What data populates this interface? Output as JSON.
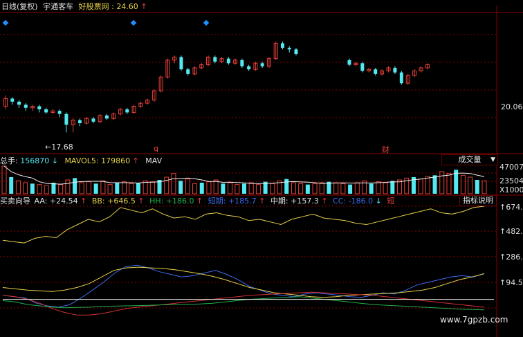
{
  "header": {
    "period_label": "日线(复权)",
    "stock_name": "宇通客车",
    "site_label": "好股票网",
    "site_value": "24.60",
    "up_arrow": "↑"
  },
  "price_panel": {
    "y_labels": [
      "20.06"
    ],
    "low_marker": "17.68",
    "marker_q": "q",
    "marker_cai": "财"
  },
  "volume_panel": {
    "total_label": "总手:",
    "total_value": "156870",
    "total_arrow": "↓",
    "mavol5_label": "MAVOL5:",
    "mavol5_value": "179860",
    "mavol5_arrow": "↑",
    "mav_truncated": "MAV",
    "dropdown_label": "成交量",
    "dropdown_arrow": "▼",
    "y_labels": [
      "47007",
      "23504",
      "X1000"
    ]
  },
  "indicator_panel": {
    "title": "买卖向导",
    "aa_label": "AA:",
    "aa_value": "+24.54",
    "aa_arrow": "↑",
    "bb_label": "BB:",
    "bb_value": "+646.5",
    "bb_arrow": "↑",
    "hh_label": "HH:",
    "hh_value": "+186.0",
    "hh_arrow": "↑",
    "short_label": "短期:",
    "short_value": "+185.7",
    "short_arrow": "↑",
    "mid_label": "中期:",
    "mid_value": "+157.3",
    "mid_arrow": "↑",
    "cc_label": "CC:",
    "cc_value": "-186.0",
    "cc_arrow": "↓",
    "trunc_label": "短",
    "help_button": "指标说明",
    "y_labels": [
      "674.5",
      "482.6",
      "286.3",
      "94.50"
    ]
  },
  "watermark": "www.7gpzb.com",
  "colors": {
    "up": "#e8413a",
    "down": "#54e8f0",
    "yellow": "#e8d24a",
    "blue": "#3d6cf0",
    "white": "#f0f0f0",
    "green": "#22b04a",
    "red_line": "#d43030",
    "grid": "#8a0000"
  },
  "chart_data": [
    {
      "type": "candlestick",
      "title": "宇通客车 日线(复权)",
      "ylim": [
        16.5,
        25.5
      ],
      "y_ticks": [
        20.06
      ],
      "candles": [
        [
          19.4,
          19.9,
          19.2,
          20.1
        ],
        [
          19.9,
          19.7,
          19.5,
          20.0
        ],
        [
          19.7,
          19.5,
          19.3,
          19.8
        ],
        [
          19.5,
          19.3,
          19.1,
          19.6
        ],
        [
          19.3,
          19.4,
          19.1,
          19.5
        ],
        [
          19.4,
          19.2,
          19.0,
          19.5
        ],
        [
          19.2,
          19.0,
          18.9,
          19.3
        ],
        [
          19.0,
          19.1,
          18.9,
          19.2
        ],
        [
          19.1,
          18.9,
          18.7,
          19.2
        ],
        [
          18.9,
          18.2,
          17.7,
          19.0
        ],
        [
          18.2,
          18.5,
          17.7,
          18.6
        ],
        [
          18.5,
          18.3,
          18.1,
          18.6
        ],
        [
          18.3,
          18.6,
          18.2,
          18.7
        ],
        [
          18.6,
          18.4,
          18.3,
          18.7
        ],
        [
          18.4,
          18.8,
          18.3,
          18.9
        ],
        [
          18.8,
          18.6,
          18.5,
          18.9
        ],
        [
          18.6,
          18.9,
          18.5,
          19.0
        ],
        [
          18.9,
          19.2,
          18.8,
          19.3
        ],
        [
          19.2,
          19.0,
          18.9,
          19.3
        ],
        [
          19.0,
          19.4,
          18.9,
          19.5
        ],
        [
          19.4,
          19.6,
          19.3,
          19.7
        ],
        [
          19.6,
          19.8,
          19.5,
          19.9
        ],
        [
          19.8,
          20.4,
          19.7,
          20.5
        ],
        [
          20.4,
          21.3,
          20.3,
          21.4
        ],
        [
          21.3,
          22.4,
          21.2,
          22.5
        ],
        [
          22.4,
          22.6,
          22.2,
          22.7
        ],
        [
          22.6,
          21.8,
          21.7,
          22.7
        ],
        [
          21.8,
          21.5,
          21.4,
          21.9
        ],
        [
          21.5,
          21.9,
          21.4,
          22.0
        ],
        [
          21.9,
          22.1,
          21.8,
          22.2
        ],
        [
          22.1,
          22.6,
          22.0,
          22.7
        ],
        [
          22.6,
          22.3,
          22.2,
          22.7
        ],
        [
          22.3,
          22.5,
          22.2,
          22.6
        ],
        [
          22.5,
          22.2,
          22.1,
          22.6
        ],
        [
          22.2,
          22.4,
          22.1,
          22.5
        ],
        [
          22.4,
          22.0,
          21.9,
          22.5
        ],
        [
          22.0,
          21.8,
          21.7,
          22.1
        ],
        [
          21.8,
          22.2,
          21.7,
          22.3
        ],
        [
          22.2,
          22.0,
          21.9,
          22.3
        ],
        [
          22.0,
          22.5,
          21.9,
          22.6
        ],
        [
          22.5,
          23.5,
          22.4,
          23.6
        ],
        [
          23.5,
          23.2,
          23.1,
          23.6
        ],
        [
          23.2,
          23.1,
          22.9,
          23.3
        ],
        [
          23.1,
          22.8,
          22.7,
          23.2
        ]
      ],
      "candles_right": [
        [
          22.4,
          22.1,
          22.0,
          22.5
        ],
        [
          22.1,
          22.2,
          22.0,
          22.3
        ],
        [
          22.2,
          21.7,
          21.6,
          22.3
        ],
        [
          21.7,
          21.8,
          21.6,
          21.9
        ],
        [
          21.8,
          21.5,
          21.4,
          21.9
        ],
        [
          21.5,
          21.7,
          21.4,
          21.8
        ],
        [
          21.7,
          21.9,
          21.6,
          22.0
        ],
        [
          21.9,
          21.6,
          21.5,
          22.0
        ],
        [
          21.6,
          20.9,
          20.8,
          21.7
        ],
        [
          20.9,
          21.4,
          20.8,
          21.5
        ],
        [
          21.4,
          21.7,
          21.3,
          21.8
        ],
        [
          21.7,
          21.9,
          21.6,
          22.0
        ],
        [
          21.9,
          22.1,
          21.8,
          22.2
        ]
      ]
    },
    {
      "type": "bar",
      "title": "成交量",
      "ylim": [
        0,
        47007
      ],
      "y_ticks": [
        23504,
        47007
      ],
      "series": [
        {
          "name": "总手",
          "values": [
            30,
            18,
            14,
            12,
            11,
            10,
            9,
            12,
            10,
            15,
            17,
            12,
            13,
            11,
            14,
            10,
            12,
            13,
            11,
            12,
            14,
            13,
            15,
            18,
            22,
            14,
            16,
            11,
            12,
            13,
            15,
            11,
            12,
            10,
            11,
            12,
            10,
            13,
            11,
            14,
            16,
            12,
            11,
            10,
            11,
            12,
            13,
            12,
            11,
            10,
            12,
            14,
            11,
            13,
            12,
            14,
            15,
            17,
            18,
            16,
            19,
            20,
            24,
            22,
            26,
            20,
            18,
            15,
            14
          ]
        }
      ]
    },
    {
      "type": "line",
      "title": "买卖向导",
      "ylim": [
        -250,
        700
      ],
      "y_ticks": [
        94.5,
        286.3,
        482.6,
        674.5
      ],
      "series": [
        {
          "name": "AA",
          "values": [
            440,
            430,
            420,
            455,
            470,
            460,
            520,
            560,
            600,
            580,
            620,
            690,
            670,
            650,
            680,
            640,
            610,
            620,
            600,
            640,
            650,
            630,
            620,
            590,
            600,
            580,
            560,
            600,
            620,
            640,
            610,
            600,
            590,
            570,
            560,
            580,
            600,
            620,
            640,
            660,
            680,
            650,
            640,
            660,
            690,
            700
          ]
        },
        {
          "name": "BB",
          "values": [
            20,
            10,
            0,
            -40,
            -60,
            -70,
            -50,
            0,
            60,
            120,
            190,
            240,
            250,
            230,
            200,
            180,
            160,
            170,
            190,
            210,
            180,
            140,
            90,
            60,
            30,
            20,
            10,
            30,
            40,
            30,
            20,
            10,
            5,
            20,
            40,
            30,
            60,
            100,
            120,
            140,
            160,
            170,
            160,
            185
          ]
        },
        {
          "name": "HH",
          "values": [
            80,
            70,
            60,
            55,
            50,
            60,
            80,
            110,
            160,
            210,
            230,
            235,
            230,
            225,
            215,
            200,
            185,
            165,
            140,
            110,
            80,
            60,
            40,
            30,
            20,
            10,
            5,
            10,
            20,
            25,
            30,
            35,
            40,
            50,
            60,
            80,
            110,
            140,
            160,
            186
          ]
        },
        {
          "name": "中期",
          "values": [
            20,
            10,
            -10,
            -40,
            -80,
            -110,
            -130,
            -130,
            -120,
            -100,
            -80,
            -70,
            -60,
            -50,
            -40,
            -30,
            -20,
            -10,
            0,
            10,
            20,
            25,
            30,
            35,
            40,
            45,
            40,
            35,
            30,
            25,
            20,
            10,
            0,
            -10,
            -20,
            -30,
            -40,
            -50,
            -60,
            -70
          ]
        },
        {
          "name": "CC",
          "values": [
            -20,
            -30,
            -50,
            -60,
            -70,
            -75,
            -72,
            -70,
            -65,
            -62,
            -60,
            -58,
            -55,
            -52,
            -50,
            -48,
            -45,
            -40,
            -30,
            -20,
            -10,
            -5,
            0,
            5,
            10,
            0,
            -10,
            -20,
            -30,
            -40,
            -50,
            -55,
            -60,
            -65,
            -70,
            -75,
            -80,
            -85,
            -88,
            -90
          ]
        }
      ]
    }
  ]
}
